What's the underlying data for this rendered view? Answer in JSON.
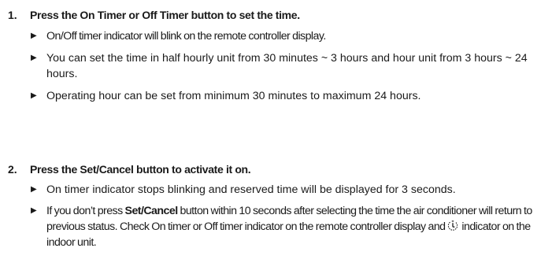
{
  "steps": [
    {
      "number": "1.",
      "heading": "Press the On Timer or Off Timer button to set the time.",
      "bullets": [
        "On/Off timer indicator will blink on the remote controller display.",
        "You can set the time in half hourly unit from 30 minutes ~ 3 hours and hour unit from 3 hours ~ 24 hours.",
        "Operating hour can be set from minimum 30 minutes to maximum 24 hours."
      ]
    },
    {
      "number": "2.",
      "heading": "Press the Set/Cancel button to activate it on.",
      "bullet_1": "On timer indicator stops blinking and reserved time will be displayed for 3 seconds.",
      "bullet_2": {
        "before_button": "If you don’t press ",
        "button_name": "Set/Cancel",
        "after_button": " button within 10 seconds after selecting the time the air conditioner will return to previous status. Check On timer or Off timer indicator on the remote controller display and",
        "icon": "timer-indicator-icon",
        "end": " indicator on the indoor unit."
      }
    }
  ],
  "bullet_marker": "▶"
}
